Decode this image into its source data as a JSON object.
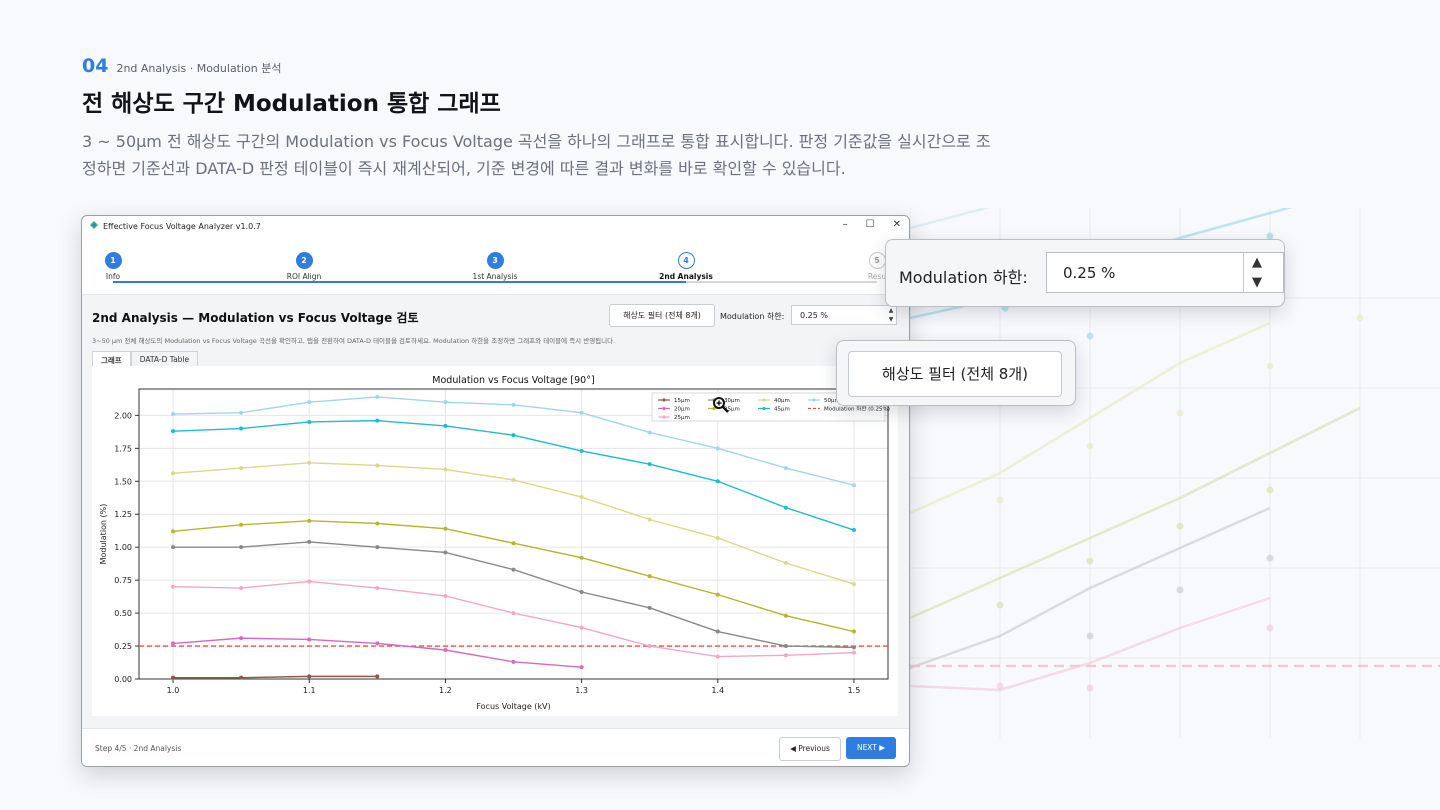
{
  "header": {
    "section_number": "04",
    "section_label": "2nd Analysis · Modulation 분석",
    "title": "전 해상도 구간 Modulation 통합 그래프",
    "description": "3 ~ 50μm 전 해상도 구간의 Modulation vs Focus Voltage 곡선을 하나의 그래프로 통합 표시합니다. 판정 기준값을 실시간으로 조정하면 기준선과 DATA-D 판정 테이블이 즉시 재계산되어, 기준 변경에 따른 결과 변화를 바로 확인할 수 있습니다."
  },
  "window": {
    "title": "Effective Focus Voltage Analyzer v1.0.7",
    "controls": {
      "minimize": "–",
      "maximize": "☐",
      "close": "✕"
    }
  },
  "steps": [
    {
      "n": "1",
      "label": "Info",
      "state": "done"
    },
    {
      "n": "2",
      "label": "ROI Align",
      "state": "done"
    },
    {
      "n": "3",
      "label": "1st Analysis",
      "state": "done"
    },
    {
      "n": "4",
      "label": "2nd Analysis",
      "state": "current"
    },
    {
      "n": "5",
      "label": "Resu",
      "state": "todo"
    }
  ],
  "panel": {
    "title": "2nd Analysis — Modulation vs Focus Voltage 검토",
    "filter_button": "해상도 필터 (전체 8개)",
    "mod_label": "Modulation 하한:",
    "mod_value": "0.25 %",
    "help_text": "3~50 μm 전체 해상도의 Modulation vs Focus Voltage 곡선을 확인하고, 탭을 전환하여 DATA-D 테이블을 검토하세요. Modulation 하한을 조정하면 그래프와 테이블에 즉시 반영됩니다.",
    "tabs": [
      "그래프",
      "DATA-D Table"
    ]
  },
  "footer": {
    "step_text": "Step 4/5  ·  2nd Analysis",
    "prev_label": "◀ Previous",
    "next_label": "NEXT ▶"
  },
  "callouts": {
    "mod_label": "Modulation 하한:",
    "mod_value": "0.25 %",
    "filter_button": "해상도 필터 (전체 8개)"
  },
  "chart_data": {
    "type": "line",
    "title": "Modulation vs Focus Voltage  [90°]",
    "xlabel": "Focus Voltage (kV)",
    "ylabel": "Modulation (%)",
    "xlim": [
      0.975,
      1.525
    ],
    "ylim": [
      0.0,
      2.2
    ],
    "x_ticks": [
      "1.0",
      "1.1",
      "1.2",
      "1.3",
      "1.4",
      "1.5"
    ],
    "y_ticks": [
      "0.00",
      "0.25",
      "0.50",
      "0.75",
      "1.00",
      "1.25",
      "1.50",
      "1.75",
      "2.00"
    ],
    "grid": true,
    "legend_position": "top-right",
    "x": [
      1.0,
      1.05,
      1.1,
      1.15,
      1.2,
      1.25,
      1.3,
      1.35,
      1.4,
      1.45,
      1.5
    ],
    "series": [
      {
        "name": "15μm",
        "color": "#8c564b",
        "values": [
          0.01,
          0.01,
          0.02,
          0.02,
          null,
          null,
          null,
          null,
          null,
          null,
          null
        ]
      },
      {
        "name": "20μm",
        "color": "#d869c3",
        "values": [
          0.27,
          0.31,
          0.3,
          0.27,
          0.22,
          0.13,
          0.09,
          null,
          null,
          null,
          null
        ]
      },
      {
        "name": "25μm",
        "color": "#f2a7c6",
        "values": [
          0.7,
          0.69,
          0.74,
          0.69,
          0.63,
          0.5,
          0.39,
          0.25,
          0.17,
          0.18,
          0.2
        ]
      },
      {
        "name": "30μm",
        "color": "#888888",
        "values": [
          1.0,
          1.0,
          1.04,
          1.0,
          0.96,
          0.83,
          0.66,
          0.54,
          0.36,
          0.25,
          0.24
        ]
      },
      {
        "name": "35μm",
        "color": "#b5b52e",
        "values": [
          1.12,
          1.17,
          1.2,
          1.18,
          1.14,
          1.03,
          0.92,
          0.78,
          0.64,
          0.48,
          0.36
        ]
      },
      {
        "name": "40μm",
        "color": "#dcd888",
        "values": [
          1.56,
          1.6,
          1.64,
          1.62,
          1.59,
          1.51,
          1.38,
          1.21,
          1.07,
          0.88,
          0.72
        ]
      },
      {
        "name": "45μm",
        "color": "#1fbccc",
        "values": [
          1.88,
          1.9,
          1.95,
          1.96,
          1.92,
          1.85,
          1.73,
          1.63,
          1.5,
          1.3,
          1.13
        ]
      },
      {
        "name": "50μm",
        "color": "#9ed8e6",
        "values": [
          2.01,
          2.02,
          2.1,
          2.14,
          2.1,
          2.08,
          2.02,
          1.87,
          1.75,
          1.6,
          1.47
        ]
      }
    ],
    "threshold": {
      "name": "Modulation 하한 (0.25%)",
      "value": 0.25,
      "color": "#d9534f"
    }
  }
}
